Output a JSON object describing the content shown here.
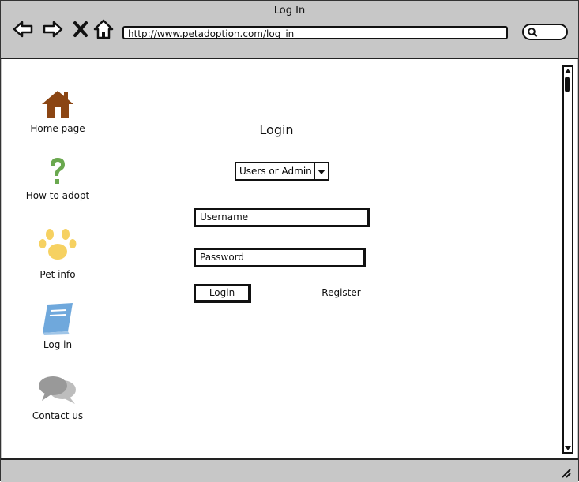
{
  "window": {
    "title": "Log In"
  },
  "browser": {
    "url": "http://www.petadoption.com/log_in",
    "icons": [
      "back-arrow-icon",
      "forward-arrow-icon",
      "close-x-icon",
      "home-outline-icon",
      "search-icon"
    ]
  },
  "sidebar": {
    "items": [
      {
        "label": "Home page",
        "icon": "house-icon",
        "color": "#8B4513"
      },
      {
        "label": "How to adopt",
        "icon": "question-mark-icon",
        "color": "#6aa84f"
      },
      {
        "label": "Pet info",
        "icon": "paw-icon",
        "color": "#f6d161"
      },
      {
        "label": "Log in",
        "icon": "book-icon",
        "color": "#6fa8dc"
      },
      {
        "label": "Contact us",
        "icon": "chat-bubbles-icon",
        "color": "#999999"
      }
    ]
  },
  "form": {
    "title": "Login",
    "role_select": "Users or Admin",
    "username_placeholder": "Username",
    "password_placeholder": "Password",
    "login_button": "Login",
    "register_link": "Register"
  }
}
